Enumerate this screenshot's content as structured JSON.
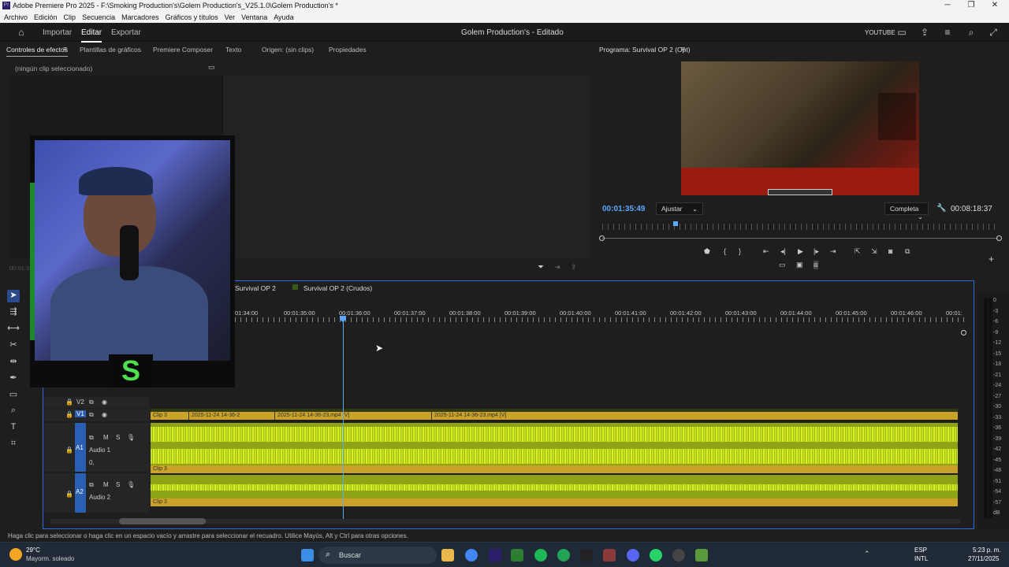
{
  "window": {
    "title": "Adobe Premiere Pro 2025 - F:\\Smoking Production's\\Golem Production's_V25.1.0\\Golem Production's *",
    "app_icon": "Pr"
  },
  "menu": [
    "Archivo",
    "Edición",
    "Clip",
    "Secuencia",
    "Marcadores",
    "Gráficos y títulos",
    "Ver",
    "Ventana",
    "Ayuda"
  ],
  "header": {
    "home_icon": "home-icon",
    "nav": [
      "Importar",
      "Editar",
      "Exportar"
    ],
    "active": "Editar",
    "project_title": "Golem Production's - Editado",
    "workspace": "YOUTUBE"
  },
  "effects_panel": {
    "tabs": [
      "Controles de efectos",
      "Plantillas de gráficos",
      "Premiere Composer",
      "Texto",
      "Origen: (sin clips)",
      "Propiedades"
    ],
    "no_clip": "(ningún clip seleccionado)",
    "timecode": "00:01:3"
  },
  "program": {
    "title": "Programa: Survival OP 2 (Opt)",
    "timecode": "00:01:35:49",
    "fit": "Ajustar",
    "quality": "Completa",
    "duration": "00:08:18:37"
  },
  "timeline": {
    "tabs": [
      "Survival OP 2",
      "Survival OP 2 (Crudos)"
    ],
    "ruler": [
      "01:34:00",
      "00:01:35:00",
      "00:01:36:00",
      "00:01:37:00",
      "00:01:38:00",
      "00:01:39:00",
      "00:01:40:00",
      "00:01:41:00",
      "00:01:42:00",
      "00:01:43:00",
      "00:01:44:00",
      "00:01:45:00",
      "00:01:46:00",
      "00:01:"
    ],
    "tracks": {
      "v2": "V2",
      "v1": "V1",
      "a1": "A1",
      "a1_name": "Audio 1",
      "a2": "A2",
      "a2_name": "Audio 2",
      "a1_vol": "0,"
    },
    "video_clips": [
      "Clip 3",
      "2025-11-24 14-36-2",
      "Clip 3",
      "2025-11-24 14-36-23.mp4 [V]",
      "Clip 3",
      "2025-11-24 14-36-23.mp4 [V]",
      "Clip 3"
    ],
    "clip_label": "Clip 3"
  },
  "vu": [
    "0",
    "-3",
    "-6",
    "-9",
    "-12",
    "-15",
    "-18",
    "-21",
    "-24",
    "-27",
    "-30",
    "-33",
    "-36",
    "-39",
    "-42",
    "-45",
    "-48",
    "-51",
    "-54",
    "-57",
    "dB"
  ],
  "status": "Haga clic para seleccionar o haga clic en un espacio vacío y arrastre para seleccionar el recuadro. Utilice Mayús, Alt y Ctrl para otras opciones.",
  "taskbar": {
    "weather_temp": "29°C",
    "weather_desc": "Mayorm. soleado",
    "search": "Buscar",
    "lang1": "ESP",
    "lang2": "INTL",
    "time": "5:23 p. m.",
    "date": "27/11/2025"
  },
  "webcam": {
    "logo": "S"
  }
}
